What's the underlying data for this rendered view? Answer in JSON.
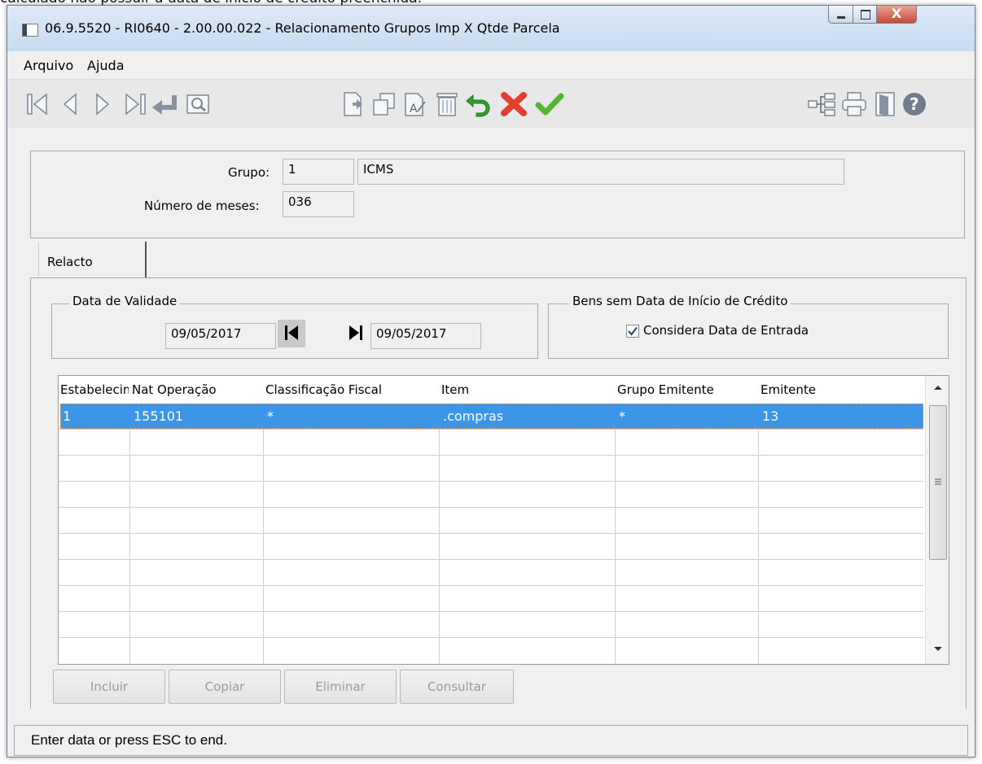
{
  "background_text": "calculado não possuir a data de início de crédito preenchida.",
  "window": {
    "title": "06.9.5520 - RI0640 - 2.00.00.022 - Relacionamento Grupos Imp X Qtde Parcela",
    "close_glyph": "X"
  },
  "menu": {
    "items": [
      {
        "label": "Arquivo"
      },
      {
        "label": "Ajuda"
      }
    ]
  },
  "toolbar": {
    "icons": [
      "first-record-icon",
      "previous-record-icon",
      "next-record-icon",
      "last-record-icon",
      "go-to-icon",
      "search-icon",
      "new-record-icon",
      "copy-record-icon",
      "edit-record-icon",
      "delete-record-icon",
      "undo-icon",
      "cancel-icon",
      "confirm-icon",
      "tree-icon",
      "print-icon",
      "exit-icon",
      "help-icon"
    ],
    "colors": {
      "undo": "#2fa12f",
      "cancel": "#e0402d",
      "confirm": "#52b630",
      "help": "#6f7d8e"
    }
  },
  "header": {
    "grupo_label": "Grupo:",
    "grupo_code": "1",
    "grupo_desc": "ICMS",
    "meses_label": "Número de meses:",
    "meses_value": "036"
  },
  "tabs": [
    {
      "label": "Relacto"
    }
  ],
  "data_validade": {
    "legend": "Data de Validade",
    "start": "09/05/2017",
    "end": "09/05/2017"
  },
  "bens": {
    "legend": "Bens sem Data de Início de Crédito",
    "checkbox_label": "Considera Data de Entrada",
    "checked": true
  },
  "grid": {
    "columns": [
      "Estabelecimento",
      "Nat Operação",
      "Classificação Fiscal",
      "Item",
      "Grupo Emitente",
      "Emitente"
    ],
    "rows": [
      {
        "estab": "1",
        "nat": "155101",
        "class": "*",
        "item": ".compras",
        "grupo_emit": "*",
        "emitente": "13"
      }
    ],
    "selection_color": "#3c95e6"
  },
  "buttons": {
    "incluir": "Incluir",
    "copiar": "Copiar",
    "eliminar": "Eliminar",
    "consultar": "Consultar"
  },
  "status": "Enter data or press ESC to end."
}
